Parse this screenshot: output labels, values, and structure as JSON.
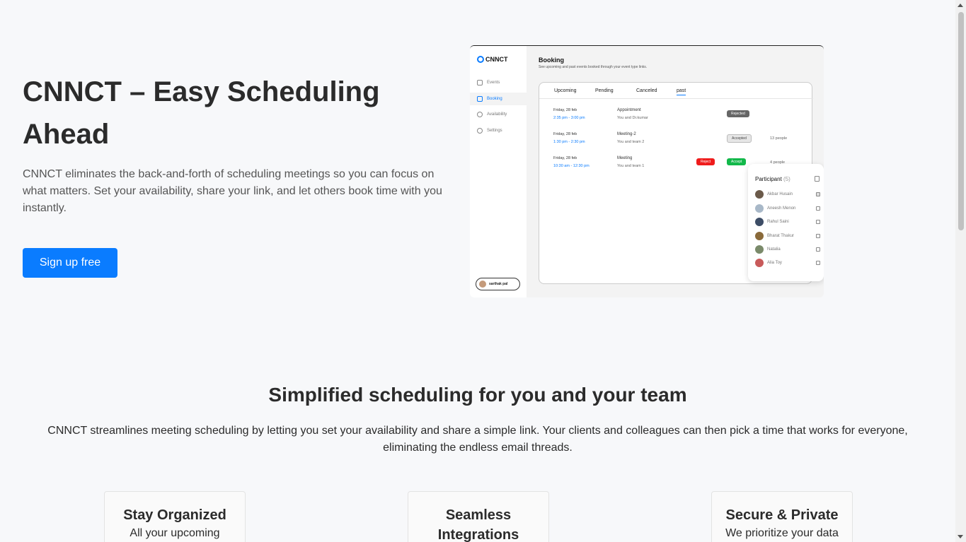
{
  "hero": {
    "title": "CNNCT – Easy Scheduling Ahead",
    "text": "CNNCT eliminates the back-and-forth of scheduling meetings so you can focus on what matters. Set your availability, share your link, and let others book time with you instantly.",
    "cta_label": "Sign up free"
  },
  "mockup": {
    "logo": "CNNCT",
    "nav": [
      "Events",
      "Booking",
      "Availability",
      "Settings"
    ],
    "user": "sarthak pal",
    "heading": "Booking",
    "subheading": "See upcoming and past events booked through your event type links.",
    "tabs": [
      "Upcoming",
      "Pending",
      "Canceled",
      "past"
    ],
    "rows": [
      {
        "date": "Friday, 28 feb",
        "time": "2:35 pm - 3:00 pm",
        "name": "Appointment",
        "who": "You and Dr.kumar",
        "badge": "Rejected",
        "people": ""
      },
      {
        "date": "Friday, 28 feb",
        "time": "1:30 pm - 2:30 pm",
        "name": "Meeting-2",
        "who": "You and team 2",
        "badge": "Accepted",
        "people": "13 people"
      },
      {
        "date": "Friday, 28 feb",
        "time": "10:30 am - 12:30 pm",
        "name": "Meeting",
        "who": "You and team 1",
        "reject": "Reject",
        "accept": "Accept",
        "people": "4 people"
      }
    ],
    "participants": {
      "title": "Participant",
      "count": "(5)",
      "list": [
        "Akbar Husain",
        "Aneesh Menon",
        "Rahul Saini",
        "Bharat Thakur",
        "Natalia",
        "Alia Toy"
      ]
    }
  },
  "section2": {
    "title": "Simplified scheduling for you and your team",
    "text": "CNNCT streamlines meeting scheduling by letting you set your availability and share a simple link. Your clients and colleagues can then pick a time that works for everyone, eliminating the endless email threads."
  },
  "cards": [
    {
      "title": "Stay Organized",
      "text": "All your upcoming"
    },
    {
      "title": "Seamless Integrations",
      "text": ""
    },
    {
      "title": "Secure & Private",
      "text": "We prioritize your data"
    }
  ]
}
